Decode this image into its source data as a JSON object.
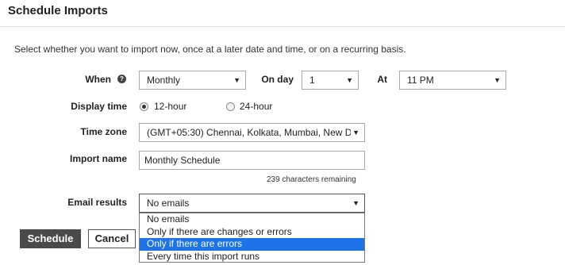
{
  "header": {
    "title": "Schedule Imports"
  },
  "instructions": "Select whether you want to import now, once at a later date and time, or on a recurring basis.",
  "when": {
    "label": "When",
    "help_icon": "question-circle-icon",
    "frequency": "Monthly",
    "on_day_label": "On day",
    "day": "1",
    "at_label": "At",
    "time": "11 PM"
  },
  "display_time": {
    "label": "Display time",
    "options": [
      "12-hour",
      "24-hour"
    ],
    "selected": "12-hour"
  },
  "time_zone": {
    "label": "Time zone",
    "value": "(GMT+05:30) Chennai, Kolkata, Mumbai, New D"
  },
  "import_name": {
    "label": "Import name",
    "value": "Monthly Schedule",
    "remaining": "239 characters remaining"
  },
  "email_results": {
    "label": "Email results",
    "value": "No emails",
    "options": [
      "No emails",
      "Only if there are changes or errors",
      "Only if there are errors",
      "Every time this import runs"
    ],
    "highlighted": "Only if there are errors"
  },
  "actions": {
    "schedule_label": "Schedule",
    "cancel_label": "Cancel"
  },
  "colors": {
    "highlight": "#1e73e8",
    "primary_button": "#4a4a4a"
  }
}
